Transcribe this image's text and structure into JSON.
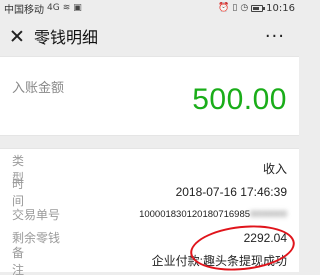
{
  "status_bar": {
    "carrier": "中国移动",
    "signal": "4G",
    "time": "10:16"
  },
  "nav": {
    "title": "零钱明细",
    "more": "···"
  },
  "amount": {
    "label": "入账金额",
    "value": "500.00"
  },
  "details": [
    {
      "label": "类 型",
      "value": "收入"
    },
    {
      "label": "时 间",
      "value": "2018-07-16 17:46:39"
    },
    {
      "label": "交易单号",
      "value": "100001830120180716985",
      "value_blurred": "0000000"
    },
    {
      "label": "剩余零钱",
      "value": "2292.04"
    },
    {
      "label": "备 注",
      "value": "企业付款:趣头条提现成功"
    }
  ],
  "colors": {
    "amount_green": "#1aad19",
    "annotation_red": "#e0141b"
  }
}
